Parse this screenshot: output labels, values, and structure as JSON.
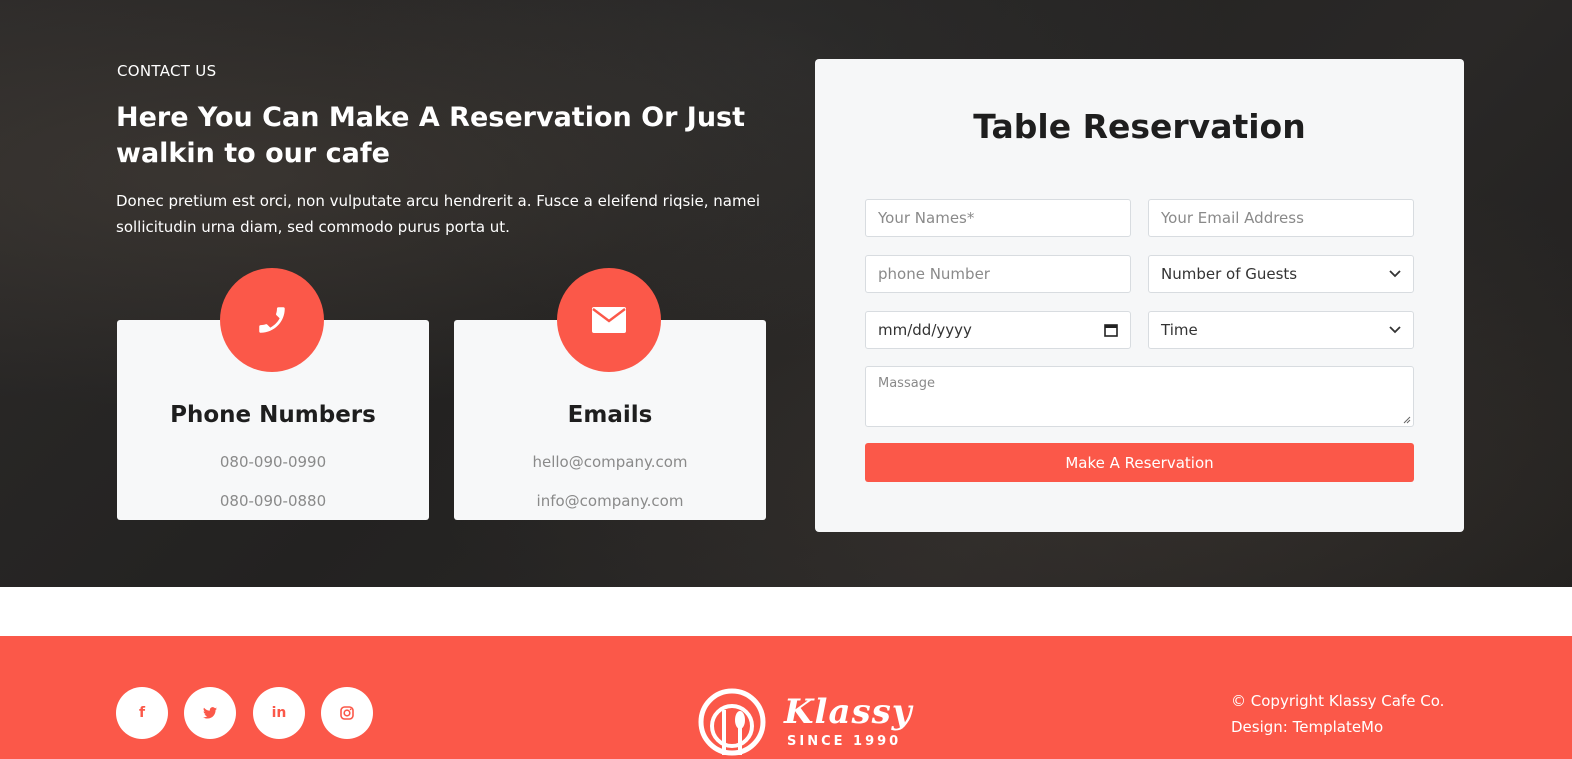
{
  "contact": {
    "label": "CONTACT US",
    "heading": "Here You Can Make A Reservation Or Just walkin to our cafe",
    "description": "Donec pretium est orci, non vulputate arcu hendrerit a. Fusce a eleifend riqsie, namei sollicitudin urna diam, sed commodo purus porta ut."
  },
  "cards": {
    "phone": {
      "icon": "phone-icon",
      "title": "Phone Numbers",
      "lines": [
        "080-090-0990",
        "080-090-0880"
      ]
    },
    "email": {
      "icon": "envelope-icon",
      "title": "Emails",
      "lines": [
        "hello@company.com",
        "info@company.com"
      ]
    }
  },
  "reservation": {
    "title": "Table Reservation",
    "name_placeholder": "Your Names*",
    "email_placeholder": "Your Email Address",
    "phone_placeholder": "phone Number",
    "guests_value": "Number of Guests",
    "date_value": "mm/dd/yyyy",
    "time_value": "Time",
    "message_placeholder": "Massage",
    "submit_label": "Make A Reservation"
  },
  "footer": {
    "social": [
      {
        "icon": "facebook-icon",
        "glyph": "f"
      },
      {
        "icon": "twitter-icon",
        "glyph": "t"
      },
      {
        "icon": "linkedin-icon",
        "glyph": "in"
      },
      {
        "icon": "instagram-icon",
        "glyph": ""
      }
    ],
    "logo_name": "Klassy",
    "logo_since": "SINCE 1990",
    "copyright": "© Copyright Klassy Cafe Co.",
    "design": "Design: TemplateMo"
  },
  "colors": {
    "accent": "#fb5849",
    "dark_bg": "#262524",
    "card_bg": "#f7f8f9"
  }
}
